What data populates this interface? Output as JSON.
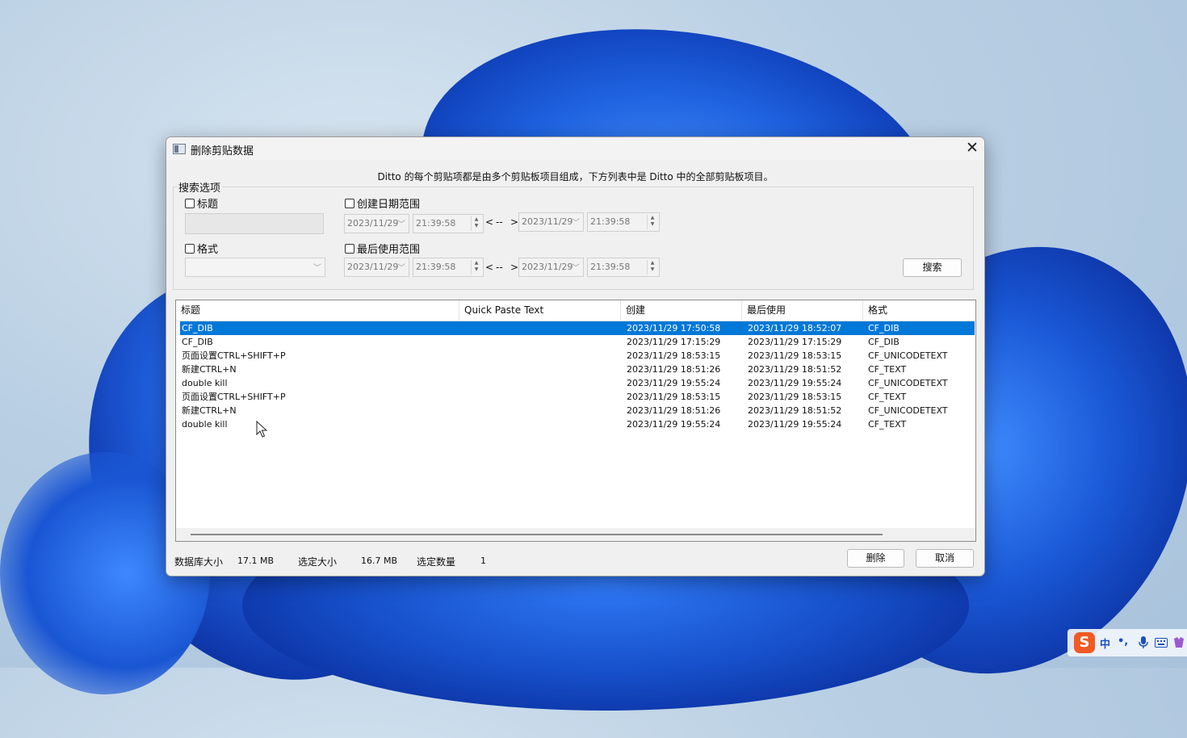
{
  "dialog": {
    "title": "删除剪贴数据",
    "close_glyph": "✕",
    "intro": "Ditto 的每个剪贴项都是由多个剪贴板项目组成，下方列表中是 Ditto 中的全部剪贴板项目。"
  },
  "search": {
    "group_label": "搜索选项",
    "title_check": "标题",
    "format_check": "格式",
    "created_check": "创建日期范围",
    "lastused_check": "最后使用范围",
    "created_from_date": "2023/11/29",
    "created_from_time": "21:39:58",
    "created_to_date": "2023/11/29",
    "created_to_time": "21:39:58",
    "lastused_from_date": "2023/11/29",
    "lastused_from_time": "21:39:58",
    "lastused_to_date": "2023/11/29",
    "lastused_to_time": "21:39:58",
    "range_lt": "<",
    "range_dash": "--",
    "range_gt": ">",
    "search_button": "搜索"
  },
  "list": {
    "columns": [
      "标题",
      "Quick Paste Text",
      "创建",
      "最后使用",
      "格式"
    ],
    "rows": [
      {
        "title": "CF_DIB",
        "qpt": "",
        "created": "2023/11/29 17:50:58",
        "last_used": "2023/11/29 18:52:07",
        "format": "CF_DIB"
      },
      {
        "title": "CF_DIB",
        "qpt": "",
        "created": "2023/11/29 17:15:29",
        "last_used": "2023/11/29 17:15:29",
        "format": "CF_DIB"
      },
      {
        "title": "页面设置CTRL+SHIFT+P",
        "qpt": "",
        "created": "2023/11/29 18:53:15",
        "last_used": "2023/11/29 18:53:15",
        "format": "CF_UNICODETEXT"
      },
      {
        "title": "新建CTRL+N",
        "qpt": "",
        "created": "2023/11/29 18:51:26",
        "last_used": "2023/11/29 18:51:52",
        "format": "CF_TEXT"
      },
      {
        "title": "double kill",
        "qpt": "",
        "created": "2023/11/29 19:55:24",
        "last_used": "2023/11/29 19:55:24",
        "format": "CF_UNICODETEXT"
      },
      {
        "title": "页面设置CTRL+SHIFT+P",
        "qpt": "",
        "created": "2023/11/29 18:53:15",
        "last_used": "2023/11/29 18:53:15",
        "format": "CF_TEXT"
      },
      {
        "title": "新建CTRL+N",
        "qpt": "",
        "created": "2023/11/29 18:51:26",
        "last_used": "2023/11/29 18:51:52",
        "format": "CF_UNICODETEXT"
      },
      {
        "title": "double kill",
        "qpt": "",
        "created": "2023/11/29 19:55:24",
        "last_used": "2023/11/29 19:55:24",
        "format": "CF_TEXT"
      }
    ],
    "selected_index": 0
  },
  "status": {
    "db_size_label": "数据库大小",
    "db_size_value": "17.1 MB",
    "sel_size_label": "选定大小",
    "sel_size_value": "16.7 MB",
    "sel_count_label": "选定数量",
    "sel_count_value": "1"
  },
  "actions": {
    "delete_button": "删除",
    "cancel_button": "取消"
  },
  "tray": {
    "ime_logo": "S",
    "ime_mode": "中",
    "punct": "•,"
  },
  "colors": {
    "selection": "#0078d7",
    "dialog_bg": "#f0f0f0"
  }
}
